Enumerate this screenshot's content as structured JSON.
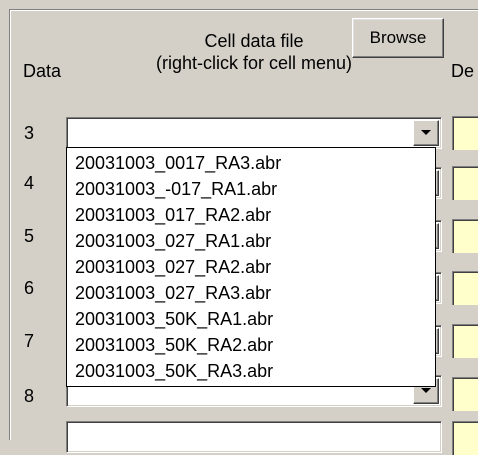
{
  "header": {
    "data_label": "Data",
    "cell_file_line1": "Cell data file",
    "cell_file_line2": "(right-click for cell menu)",
    "browse_label": "Browse",
    "desc_label_partial": "De"
  },
  "rows": [
    {
      "number": "3",
      "value": ""
    },
    {
      "number": "4",
      "value": ""
    },
    {
      "number": "5",
      "value": ""
    },
    {
      "number": "6",
      "value": ""
    },
    {
      "number": "7",
      "value": ""
    },
    {
      "number": "8",
      "value": ""
    }
  ],
  "dropdown": {
    "options": [
      "20031003_0017_RA3.abr",
      "20031003_-017_RA1.abr",
      "20031003_017_RA2.abr",
      "20031003_027_RA1.abr",
      "20031003_027_RA2.abr",
      "20031003_027_RA3.abr",
      "20031003_50K_RA1.abr",
      "20031003_50K_RA2.abr",
      "20031003_50K_RA3.abr"
    ]
  },
  "colors": {
    "face": "#d4d0c8",
    "desc_cell": "#ffffcc",
    "field": "#ffffff"
  },
  "icons": {
    "combo_button": "chevron-down-icon"
  }
}
